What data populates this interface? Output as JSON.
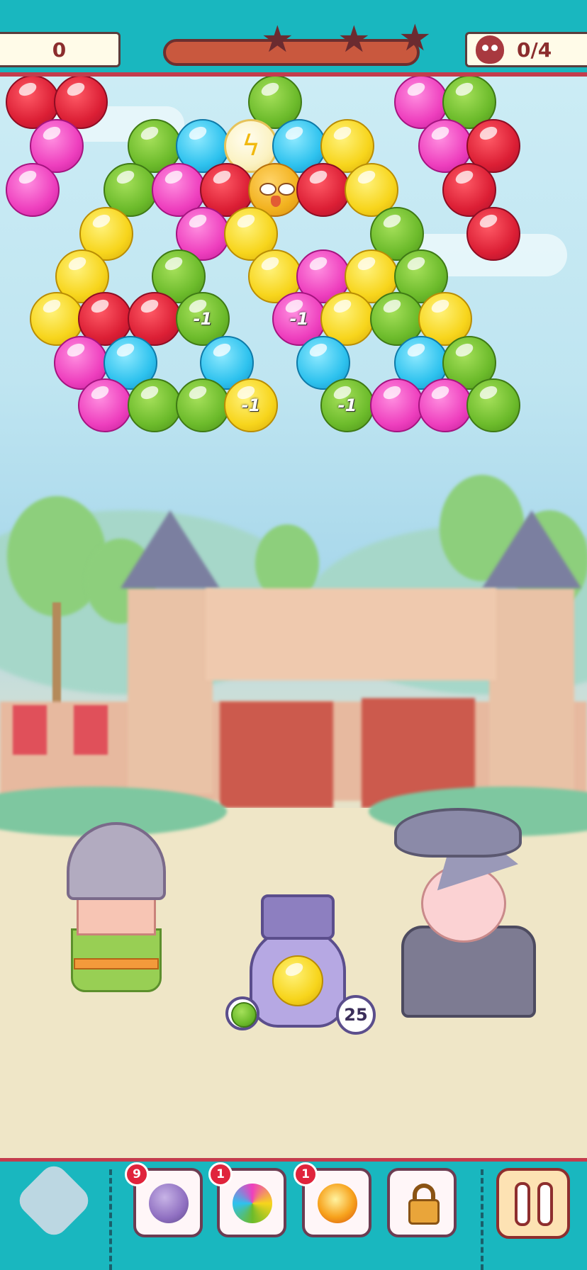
{
  "hud": {
    "score": "0",
    "goal": "0/4",
    "stars": [
      "star",
      "star",
      "star"
    ],
    "goal_icon": "bird-icon"
  },
  "board": {
    "colors": {
      "red": "#dc1f35",
      "green": "#6cbb2b",
      "pink": "#ee3fbe",
      "blue": "#2ec2ee",
      "yellow": "#f7d51c"
    },
    "minus_label": "-1",
    "special_icons": [
      "lightning-bubble-icon",
      "trapped-bird-icon"
    ]
  },
  "shooter": {
    "current_color": "yellow",
    "next_color": "green",
    "shots_left": "25"
  },
  "characters": [
    "knight",
    "robot-shooter",
    "witch"
  ],
  "boosters": [
    {
      "name": "bomb",
      "count": "9",
      "icon": "skull-bomb-icon"
    },
    {
      "name": "rainbow",
      "count": "1",
      "icon": "rainbow-ball-icon"
    },
    {
      "name": "fireball",
      "count": "1",
      "icon": "fireball-icon"
    },
    {
      "name": "locked",
      "icon": "padlock-icon"
    }
  ],
  "controls": {
    "home_icon": "castle-icon",
    "pause_icon": "pause-icon"
  }
}
